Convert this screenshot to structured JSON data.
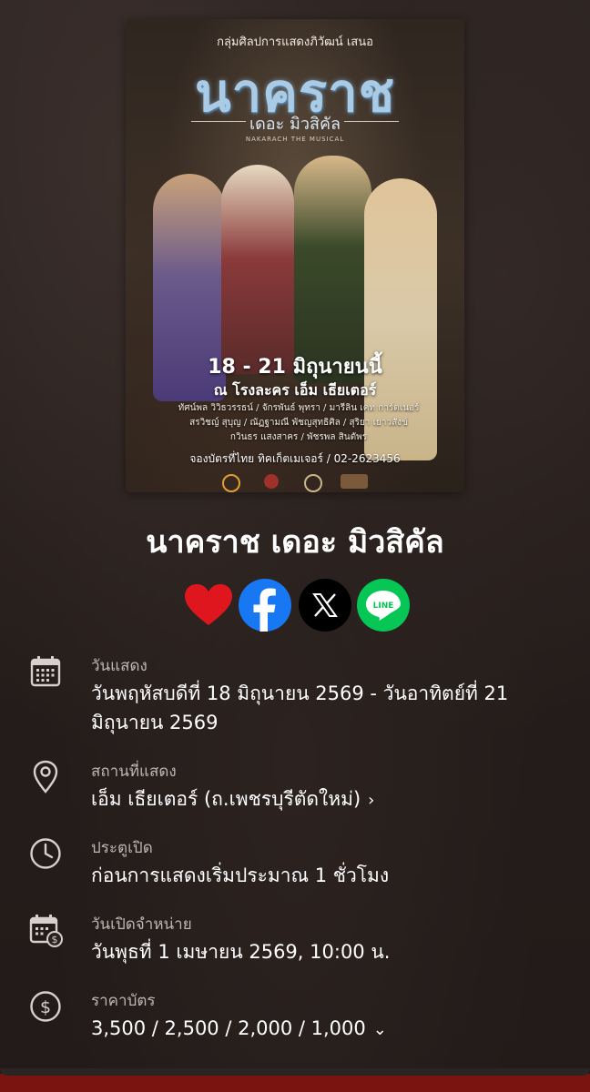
{
  "poster": {
    "presenter": "กลุ่มศิลปการแสดงภิวัฒน์ เสนอ",
    "title": "นาคราช",
    "subtitle": "เดอะ มิวสิคัล",
    "english_title": "NAKARACH THE MUSICAL",
    "dates": "18 - 21 มิถุนายนนี้",
    "venue": "ณ โรงละคร เอ็ม เธียเตอร์",
    "cast_line1": "ทัศน์พล วิวิธวรรธน์ / จักรพันธ์ พุทรา / มารีลิน เคท การ์ดเนอร์",
    "cast_line2": "สรวิชญ์ สุบุญ / ณัฏฐามณี พัชญสุทธิศิล / สุริยา เยาวสังข์",
    "cast_line3": "กวินธร แสงสาคร / พัชรพล สินตัพร",
    "booking": "จองบัตรที่ไทย ทิคเก็ตเมเจอร์ / 02-2623456"
  },
  "event": {
    "title": "นาคราช เดอะ มิวสิคัล"
  },
  "share": {
    "favorite_icon": "heart-icon",
    "facebook_icon": "facebook-icon",
    "x_icon": "x-icon",
    "line_icon": "line-icon",
    "line_text": "LINE",
    "colors": {
      "heart": "#e0161e",
      "facebook": "#1877f2",
      "x": "#000000",
      "line": "#06c755"
    }
  },
  "details": {
    "show_date": {
      "label": "วันแสดง",
      "value": "วันพฤหัสบดีที่ 18 มิถุนายน 2569 - วันอาทิตย์ที่ 21 มิถุนายน 2569",
      "icon": "calendar-icon"
    },
    "venue": {
      "label": "สถานที่แสดง",
      "value": "เอ็ม เธียเตอร์ (ถ.เพชรบุรีตัดใหม่)",
      "icon": "location-pin-icon"
    },
    "doors": {
      "label": "ประตูเปิด",
      "value": "ก่อนการแสดงเริ่มประมาณ 1 ชั่วโมง",
      "icon": "clock-icon"
    },
    "sale_date": {
      "label": "วันเปิดจำหน่าย",
      "value": "วันพุธที่ 1 เมษายน 2569, 10:00 น.",
      "icon": "calendar-price-icon"
    },
    "price": {
      "label": "ราคาบัตร",
      "value": "3,500 / 2,500 / 2,000 / 1,000",
      "icon": "dollar-icon"
    }
  }
}
